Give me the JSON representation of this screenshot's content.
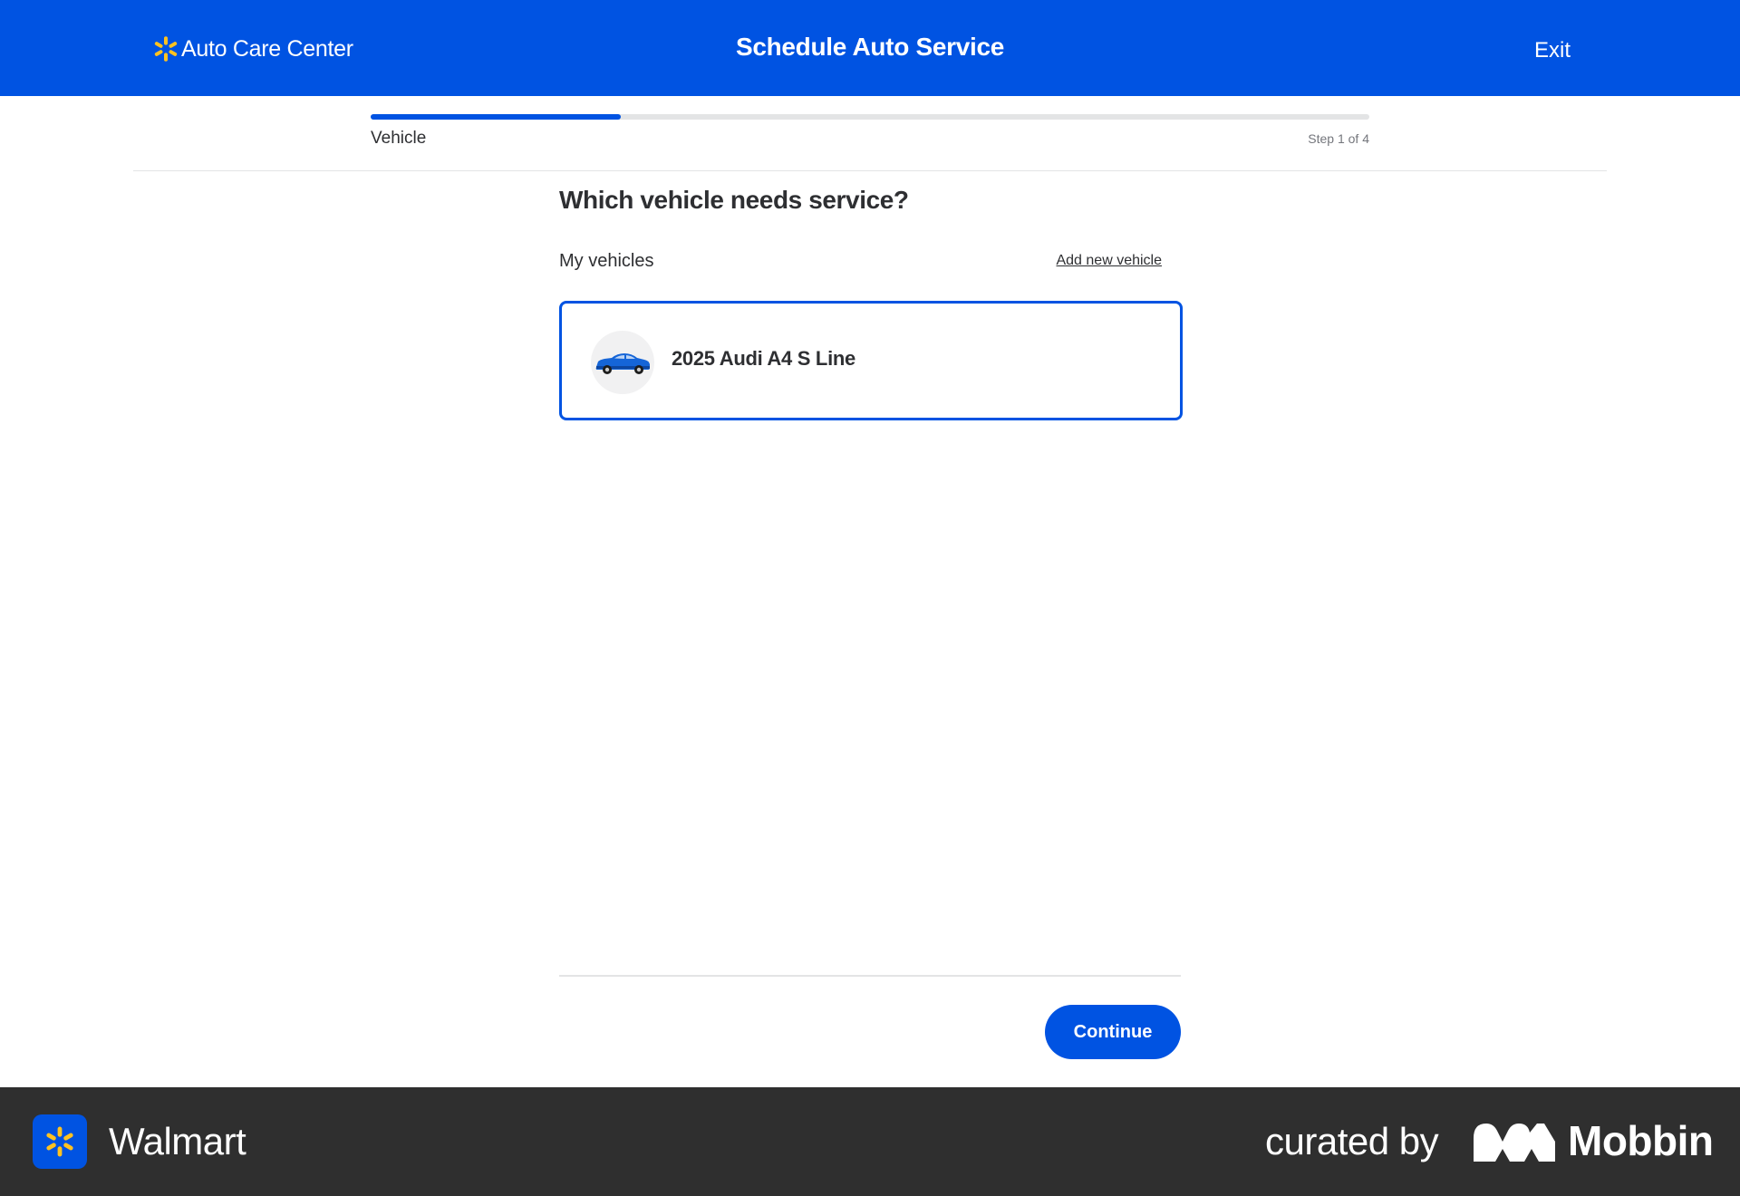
{
  "header": {
    "brand_name": "Auto Care Center",
    "title": "Schedule Auto Service",
    "exit_label": "Exit",
    "brand_icon": "spark-icon"
  },
  "progress": {
    "step_name": "Vehicle",
    "step_count": "Step 1 of 4",
    "fraction": 0.25
  },
  "main": {
    "question": "Which vehicle needs service?",
    "section_label": "My vehicles",
    "add_vehicle_label": "Add new vehicle",
    "vehicles": [
      {
        "name": "2025 Audi A4 S Line",
        "icon": "car-icon",
        "selected": true
      }
    ],
    "continue_label": "Continue"
  },
  "footer": {
    "app_name": "Walmart",
    "curated_by": "curated by",
    "curator_name": "Mobbin"
  },
  "colors": {
    "brand_blue": "#0053e2",
    "spark_yellow": "#ffc220",
    "footer_bg": "#2f2f2f"
  }
}
